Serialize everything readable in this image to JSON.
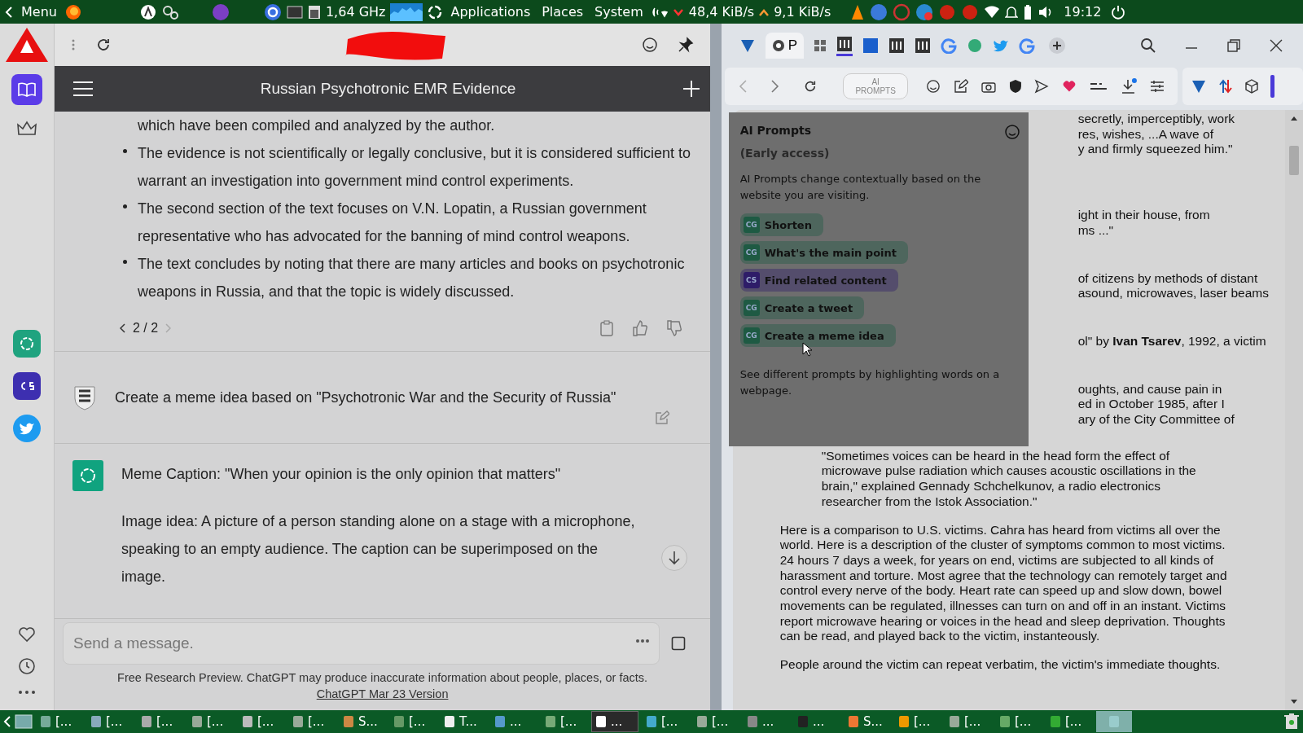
{
  "top_panel": {
    "menu": "Menu",
    "cpu_freq": "1,64 GHz",
    "menus": [
      "Applications",
      "Places",
      "System"
    ],
    "download_rate": "48,4 KiB/s",
    "upload_rate": "9,1 KiB/s",
    "clock": "19:12"
  },
  "chat": {
    "title": "Russian Psychotronic EMR Evidence",
    "messages": [
      {
        "kind": "answer_tail",
        "lead": "which have been compiled and analyzed by the author.",
        "bullets": [
          "The evidence is not scientifically or legally conclusive, but it is considered sufficient to warrant an investigation into government mind control experiments.",
          "The second section of the text focuses on V.N. Lopatin, a Russian government representative who has advocated for the banning of mind control weapons.",
          "The text concludes by noting that there are many articles and books on psychotronic weapons in Russia, and that the topic is widely discussed."
        ],
        "pager": "2 / 2"
      },
      {
        "kind": "user",
        "text": "Create a meme idea based on \"Psychotronic War and the Security of Russia\""
      },
      {
        "kind": "bot",
        "paragraphs": [
          "Meme Caption: \"When your opinion is the only opinion that matters\"",
          "Image idea: A picture of a person standing alone on a stage with a microphone, speaking to an empty audience. The caption can be superimposed on the image."
        ]
      }
    ],
    "input": {
      "placeholder": "Send a message."
    },
    "footer": {
      "text": "Free Research Preview. ChatGPT may produce inaccurate information about people, places, or facts.",
      "link": "ChatGPT Mar 23 Version"
    }
  },
  "browser": {
    "tab_label": "P",
    "ai_prompts_button": "AI PROMPTS",
    "ai_prompts": {
      "title": "AI Prompts",
      "subtitle": "(Early access)",
      "description": "AI Prompts change contextually based on the website you are visiting.",
      "prompts": [
        {
          "badge": "CG",
          "label": "Shorten",
          "color": "#1e5a43"
        },
        {
          "badge": "CG",
          "label": "What's the main point",
          "color": "#1e5a43"
        },
        {
          "badge": "CS",
          "label": "Find related content",
          "color": "#2e1c68"
        },
        {
          "badge": "CG",
          "label": "Create a tweet",
          "color": "#1e5a43"
        },
        {
          "badge": "CG",
          "label": "Create a meme idea",
          "color": "#1e5a43"
        }
      ],
      "hint": "See different prompts by highlighting words on a webpage."
    },
    "document": {
      "fragments": [
        [
          "secretly, imperceptibly, work",
          "res, wishes, ...A wave of",
          "y and firmly squeezed him.\""
        ],
        [
          "ight in their house, from",
          "ms ...\""
        ],
        [
          "of citizens by methods of distant",
          "asound, microwaves, laser beams"
        ],
        [
          "ol\" by **Ivan Tsarev**, 1992, a victim"
        ],
        [
          "oughts, and cause pain in",
          "ed in October 1985, after I",
          "ary of the City Committee of"
        ]
      ],
      "quote": "\"Sometimes voices can be heard in the head form the effect of microwave pulse radiation which causes acoustic oscillations in the brain,\" explained Gennady Schchelkunov, a radio electronics researcher from the Istok Association.\"",
      "paragraphs": [
        "Here is a comparison to U.S. victims. Cahra has heard from victims all over the world. Here is a description of the cluster of symptoms common to most victims. 24 hours 7 days a week, for years on end, victims are subjected to all kinds of harassment and torture. Most agree that the technology can remotely target and control every nerve of the body. Heart rate can speed up and slow down, bowel movements can be regulated, illnesses can turn on and off in an instant. Victims report microwave hearing or voices in the head and sleep deprivation. Thoughts can be read, and played back to the victim, instanteously.",
        "People around the victim can repeat verbatim, the victim's immediate thoughts."
      ]
    }
  },
  "taskbar": {
    "items": [
      {
        "label": "[...",
        "selected": false,
        "kind": "normal"
      },
      {
        "label": "[...",
        "selected": false,
        "kind": "normal"
      },
      {
        "label": "[...",
        "selected": false,
        "kind": "normal"
      },
      {
        "label": "[...",
        "selected": false,
        "kind": "normal"
      },
      {
        "label": "[...",
        "selected": false,
        "kind": "normal"
      },
      {
        "label": "[...",
        "selected": false,
        "kind": "normal"
      },
      {
        "label": "S...",
        "selected": false,
        "kind": "normal"
      },
      {
        "label": "[...",
        "selected": false,
        "kind": "normal"
      },
      {
        "label": "T...",
        "selected": false,
        "kind": "normal"
      },
      {
        "label": "...",
        "selected": false,
        "kind": "normal"
      },
      {
        "label": "[...",
        "selected": false,
        "kind": "normal"
      },
      {
        "label": "...",
        "selected": false,
        "kind": "dark"
      },
      {
        "label": "[...",
        "selected": false,
        "kind": "normal"
      },
      {
        "label": "[...",
        "selected": false,
        "kind": "normal"
      },
      {
        "label": "...",
        "selected": false,
        "kind": "normal"
      },
      {
        "label": "...",
        "selected": false,
        "kind": "normal"
      },
      {
        "label": "S...",
        "selected": false,
        "kind": "normal"
      },
      {
        "label": "[...",
        "selected": false,
        "kind": "normal"
      },
      {
        "label": "[...",
        "selected": false,
        "kind": "normal"
      },
      {
        "label": "[...",
        "selected": false,
        "kind": "normal"
      },
      {
        "label": "[...",
        "selected": false,
        "kind": "normal"
      },
      {
        "selected": true,
        "kind": "normal"
      }
    ]
  }
}
